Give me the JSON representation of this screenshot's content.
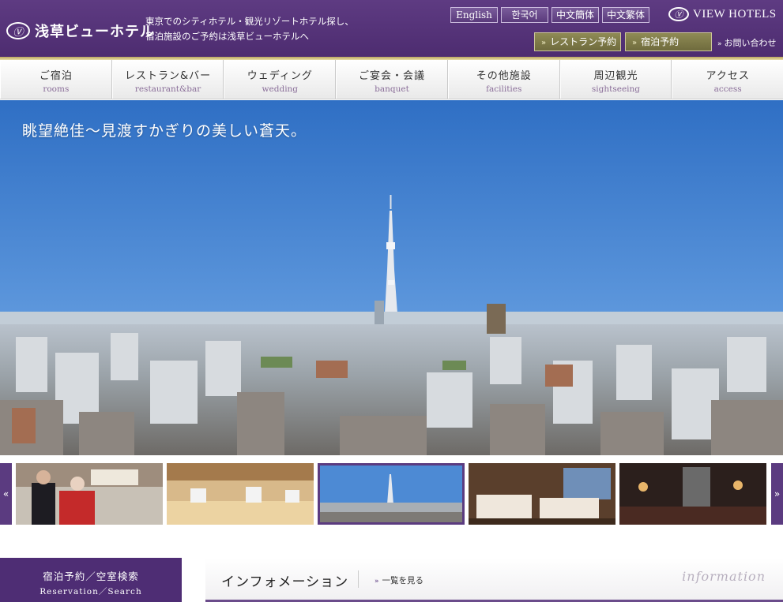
{
  "header": {
    "logo_mark": "Ⓥ",
    "logo_text": "浅草ビューホテル",
    "tagline_line1": "東京でのシティホテル・観光リゾートホテル探し、",
    "tagline_line2": "宿泊施設のご予約は浅草ビューホテルへ",
    "languages": [
      "English",
      "한국어",
      "中文簡体",
      "中文繁体"
    ],
    "brand_mark": "Ⓥ",
    "brand_text": "VIEW HOTELS",
    "restaurant_reserve": "レストラン予約",
    "stay_reserve": "宿泊予約",
    "contact": "お問い合わせ",
    "arrow": "»"
  },
  "nav": [
    {
      "jp": "ご宿泊",
      "en": "rooms"
    },
    {
      "jp": "レストラン&バー",
      "en": "restaurant&bar"
    },
    {
      "jp": "ウェディング",
      "en": "wedding"
    },
    {
      "jp": "ご宴会・会議",
      "en": "banquet"
    },
    {
      "jp": "その他施設",
      "en": "facilities"
    },
    {
      "jp": "周辺観光",
      "en": "sightseeing"
    },
    {
      "jp": "アクセス",
      "en": "access"
    }
  ],
  "hero": {
    "caption": "眺望絶佳～見渡すかぎりの美しい蒼天。"
  },
  "thumbnails": {
    "prev": "«",
    "next": "»",
    "active_index": 2
  },
  "search_box": {
    "jp": "宿泊予約／空室検索",
    "en": "Reservation／Search"
  },
  "info": {
    "title": "インフォメーション",
    "link": "一覧を見る",
    "arrow": "»",
    "watermark": "information"
  },
  "colors": {
    "brand_purple": "#4e2d74",
    "gold_button": "#7d7946",
    "sky": "#3f7fcf"
  }
}
